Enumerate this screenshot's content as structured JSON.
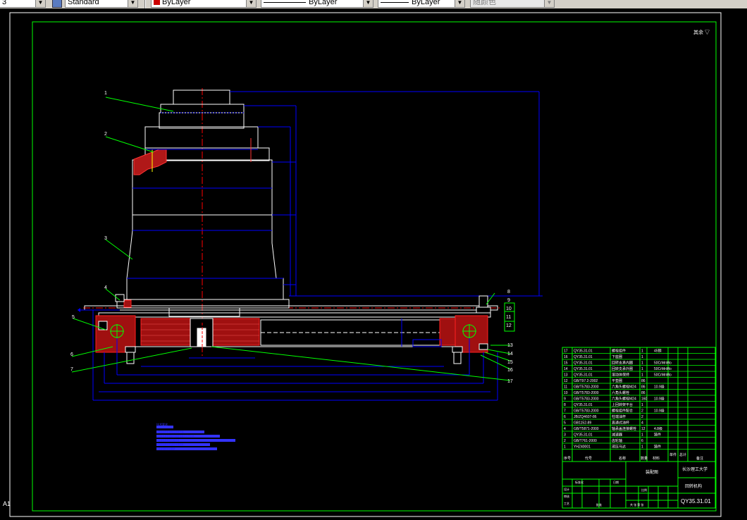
{
  "toolbar": {
    "textstyle_value": "Standard",
    "color_value": "ByLayer",
    "linetype_value": "ByLayer",
    "lineweight_value": "ByLayer",
    "plotstyle_value": "随颜色",
    "layer_fragment": "3",
    "colors": {
      "bylayer_swatch": "#cc0000"
    }
  },
  "drawing": {
    "roughness_mark": "其余 ▽",
    "sheet_tab": "A1",
    "balloons": [
      "1",
      "2",
      "3",
      "4",
      "5",
      "6",
      "7",
      "8",
      "9",
      "10",
      "11",
      "12",
      "13",
      "14",
      "15",
      "16",
      "17"
    ],
    "right_balloons": [
      "8",
      "9",
      "10",
      "11",
      "12",
      "13",
      "14",
      "15",
      "16",
      "17"
    ]
  },
  "bom": {
    "rows": [
      {
        "no": "17",
        "code": "QY35.31.01",
        "name": "螺栓组件",
        "qty": "1",
        "mat": "45钢"
      },
      {
        "no": "16",
        "code": "QY35.31.01",
        "name": "下座圈",
        "qty": "1",
        "mat": ""
      },
      {
        "no": "15",
        "code": "QY35.31.01",
        "name": "回转支承内圈",
        "qty": "1",
        "mat": "50CrMnMo"
      },
      {
        "no": "14",
        "code": "QY35.31.01",
        "name": "回转支承外圈",
        "qty": "1",
        "mat": "50CrMnMo"
      },
      {
        "no": "13",
        "code": "QY35.31.01",
        "name": "滚动体保持",
        "qty": "1",
        "mat": "50CrMnMo"
      },
      {
        "no": "12",
        "code": "GB/T97.2-2002",
        "name": "平垫圈",
        "qty": "86",
        "mat": ""
      },
      {
        "no": "11",
        "code": "GB/T5783-2000",
        "name": "六角头螺栓M24",
        "qty": "86",
        "mat": "10.9级"
      },
      {
        "no": "10",
        "code": "GB/T5783-2000",
        "name": "六角头螺栓",
        "qty": "86",
        "mat": ""
      },
      {
        "no": "9",
        "code": "GB/T5783-2000",
        "name": "六角头螺栓M24",
        "qty": "160",
        "mat": "10.9级"
      },
      {
        "no": "8",
        "code": "QY35.31.01",
        "name": "上回转架平台",
        "qty": "1",
        "mat": ""
      },
      {
        "no": "7",
        "code": "GB/T5783-2000",
        "name": "螺栓组件配合",
        "qty": "2",
        "mat": "10.9级"
      },
      {
        "no": "6",
        "code": "JB/ZQ4607-86",
        "name": "柱端油杯",
        "qty": "2",
        "mat": ""
      },
      {
        "no": "5",
        "code": "GB1152-89",
        "name": "直通式油杯",
        "qty": "4",
        "mat": ""
      },
      {
        "no": "4",
        "code": "GB/T5871-2000",
        "name": "轴承盖连接螺栓",
        "qty": "12",
        "mat": "4.8级"
      },
      {
        "no": "3",
        "code": "QY35.31.01",
        "name": "减速器",
        "qty": "1",
        "mat": "铸件"
      },
      {
        "no": "2",
        "code": "GB/T761-2000",
        "name": "齿轮轴",
        "qty": "6",
        "mat": ""
      },
      {
        "no": "1",
        "code": "YHZ40001",
        "name": "液压马达",
        "qty": "1",
        "mat": "铸件"
      }
    ],
    "header": {
      "no": "序号",
      "code": "代号",
      "name": "名称",
      "qty": "数量",
      "mat": "材料",
      "wt1": "单件",
      "wt2": "总计",
      "remark": "备注"
    },
    "title_block": {
      "school": "长沙理工大学",
      "drawing_name": "回转机构",
      "drawing_no": "QY35.31.01",
      "stage": "装配图",
      "scale_label": "比例",
      "sheet_label": "共 张 第 张",
      "weight": "",
      "row_labels": [
        "设计",
        "审核",
        "工艺",
        "批准",
        "标准化",
        "日期"
      ]
    }
  },
  "notes": {
    "title": "技术要求",
    "lines": [
      "1.装配前所有零件应清洗干净",
      "2.回转支承安装面平面度误差不大于0.15",
      "3.各螺栓按规定力矩拧紧",
      "4.装配后转动灵活无卡滞现象",
      "5.啮合侧隙符合要求"
    ]
  }
}
